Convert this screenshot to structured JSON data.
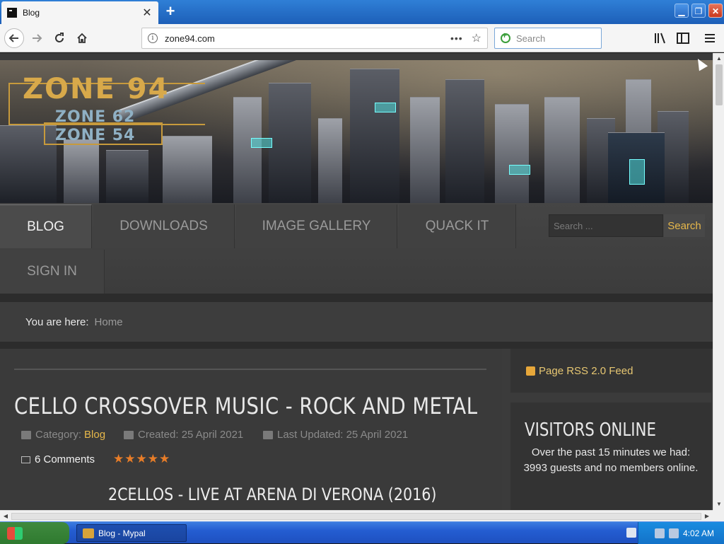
{
  "browser": {
    "tab_title": "Blog",
    "url": "zone94.com",
    "search_placeholder": "Search",
    "newtab_symbol": "+",
    "close_symbol": "✕",
    "dots_symbol": "•••",
    "star_symbol": "☆"
  },
  "site": {
    "logo_main": "ZONE 94",
    "logo_sub1": "ZONE 62",
    "logo_sub2": "ZONE 54",
    "menu": [
      "BLOG",
      "DOWNLOADS",
      "IMAGE GALLERY",
      "QUACK IT",
      "SIGN IN"
    ],
    "search_placeholder": "Search ...",
    "search_button": "Search",
    "breadcrumb_label": "You are here:",
    "breadcrumb_home": "Home"
  },
  "article": {
    "title": "CELLO CROSSOVER MUSIC - ROCK AND METAL",
    "category_label": "Category:",
    "category_link": "Blog",
    "created": "Created: 25 April 2021",
    "updated": "Last Updated: 25 April 2021",
    "comments": "6 Comments",
    "rating": 5,
    "stars": "★★★★★",
    "subtitle": "2CELLOS - LIVE AT ARENA DI VERONA (2016)"
  },
  "sidebar": {
    "rss": "Page RSS 2.0 Feed",
    "visitors_title": "VISITORS ONLINE",
    "visitors_text": "Over the past 15 minutes we had: 3993 guests and no members online."
  },
  "taskbar": {
    "task": "Blog - Mypal",
    "time": "4:02 AM"
  },
  "colors": {
    "accent": "#e7b84a",
    "star": "#e87d28",
    "xp_blue": "#245dd1"
  }
}
